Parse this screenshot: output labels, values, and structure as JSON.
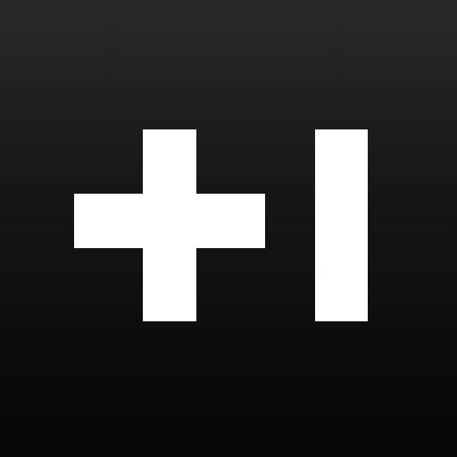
{
  "icon": {
    "glyph_text": "+1",
    "glyph_color": "#ffffff",
    "background_top": "#2a2a2a",
    "background_bottom": "#060606"
  }
}
